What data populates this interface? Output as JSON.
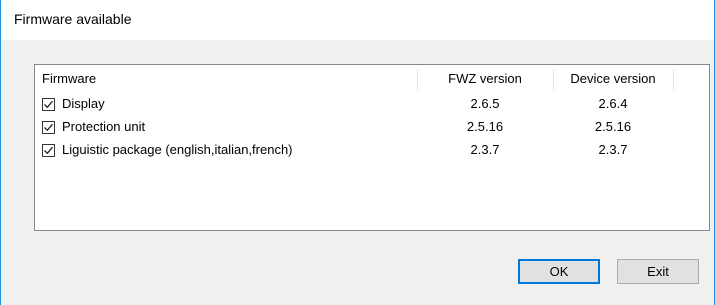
{
  "window": {
    "title": "Firmware available"
  },
  "list": {
    "columns": [
      "Firmware",
      "FWZ version",
      "Device version"
    ],
    "rows": [
      {
        "checked": true,
        "name": "Display",
        "fwz": "2.6.5",
        "device": "2.6.4"
      },
      {
        "checked": true,
        "name": "Protection unit",
        "fwz": "2.5.16",
        "device": "2.5.16"
      },
      {
        "checked": true,
        "name": "Liguistic package (english,italian,french)",
        "fwz": "2.3.7",
        "device": "2.3.7"
      }
    ]
  },
  "buttons": {
    "ok_label": "OK",
    "exit_label": "Exit"
  },
  "icons": {
    "checkbox": "checkmark-icon"
  },
  "colors": {
    "window_border": "#1e90d6",
    "client_bg": "#f0f0f0",
    "default_button_border": "#0078d7"
  }
}
